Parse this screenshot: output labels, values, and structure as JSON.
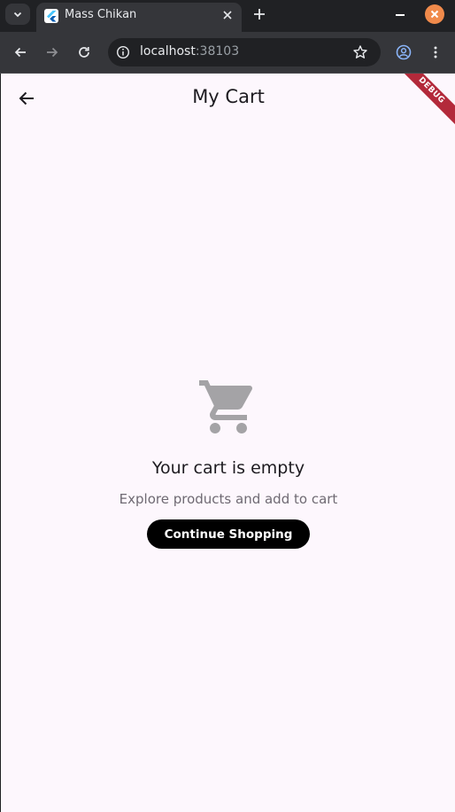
{
  "browser": {
    "tab_title": "Mass Chikan",
    "url_host": "localhost",
    "url_port": ":38103"
  },
  "app": {
    "title": "My Cart",
    "debug_banner": "DEBUG",
    "empty_state": {
      "icon": "shopping-cart-icon",
      "title": "Your cart is empty",
      "subtitle": "Explore products and add to cart",
      "button_label": "Continue Shopping"
    }
  },
  "colors": {
    "app_background": "#fdf7fd",
    "button_background": "#000000",
    "icon_color": "#a4a3a6",
    "debug_ribbon": "#b3293a",
    "window_close": "#f08a4b"
  }
}
